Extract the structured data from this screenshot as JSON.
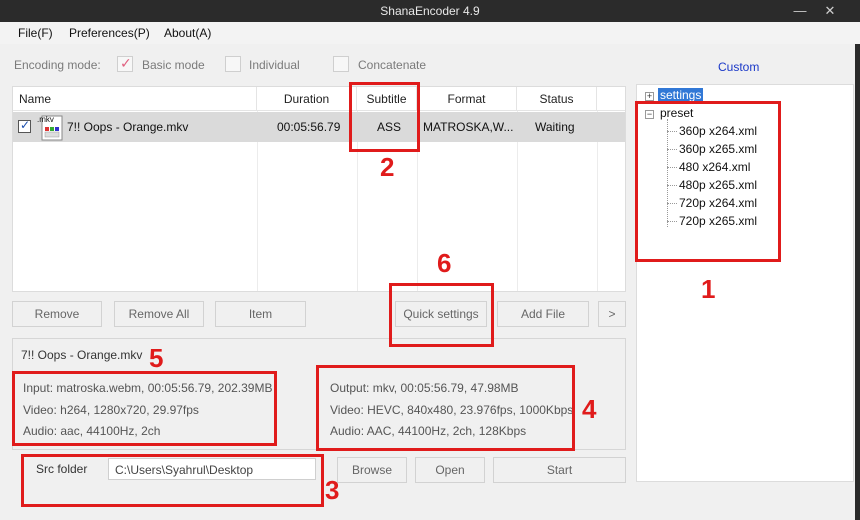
{
  "window": {
    "title": "ShanaEncoder 4.9",
    "minimize": "—",
    "close": "✕"
  },
  "menu": [
    "File(F)",
    "Preferences(P)",
    "About(A)"
  ],
  "encoding_mode": {
    "label": "Encoding mode:",
    "options": [
      {
        "label": "Basic mode",
        "checked": true
      },
      {
        "label": "Individual",
        "checked": false
      },
      {
        "label": "Concatenate",
        "checked": false
      }
    ]
  },
  "custom_link": "Custom",
  "file_table": {
    "columns": [
      "Name",
      "Duration",
      "Subtitle",
      "Format",
      "Status"
    ],
    "rows": [
      {
        "checked": true,
        "icon_ext": ".mkv",
        "name": "7!! Oops - Orange.mkv",
        "duration": "00:05:56.79",
        "subtitle": "ASS",
        "format": "MATROSKA,W...",
        "status": "Waiting"
      }
    ]
  },
  "tree": {
    "settings": "settings",
    "preset": "preset",
    "presets": [
      "360p x264.xml",
      "360p x265.xml",
      "480 x264.xml",
      "480p x265.xml",
      "720p x264.xml",
      "720p x265.xml"
    ]
  },
  "buttons": {
    "remove": "Remove",
    "remove_all": "Remove All",
    "item": "Item",
    "quick_settings": "Quick settings",
    "add_file": "Add File",
    "more": ">",
    "browse": "Browse",
    "open": "Open",
    "start": "Start"
  },
  "info": {
    "filename": "7!! Oops - Orange.mkv",
    "input": "Input: matroska.webm, 00:05:56.79, 202.39MB",
    "input_video": "Video: h264, 1280x720, 29.97fps",
    "input_audio": "Audio: aac, 44100Hz, 2ch",
    "output": "Output: mkv, 00:05:56.79, 47.98MB",
    "output_video": "Video: HEVC, 840x480, 23.976fps, 1000Kbps",
    "output_audio": "Audio: AAC, 44100Hz, 2ch, 128Kbps"
  },
  "src_folder": {
    "label": "Src folder",
    "value": "C:\\Users\\Syahrul\\Desktop"
  },
  "annotations": [
    "1",
    "2",
    "3",
    "4",
    "5",
    "6"
  ],
  "colors": {
    "annotation": "#e01b1b",
    "selection": "#3178d6",
    "link": "#1a38c8"
  }
}
